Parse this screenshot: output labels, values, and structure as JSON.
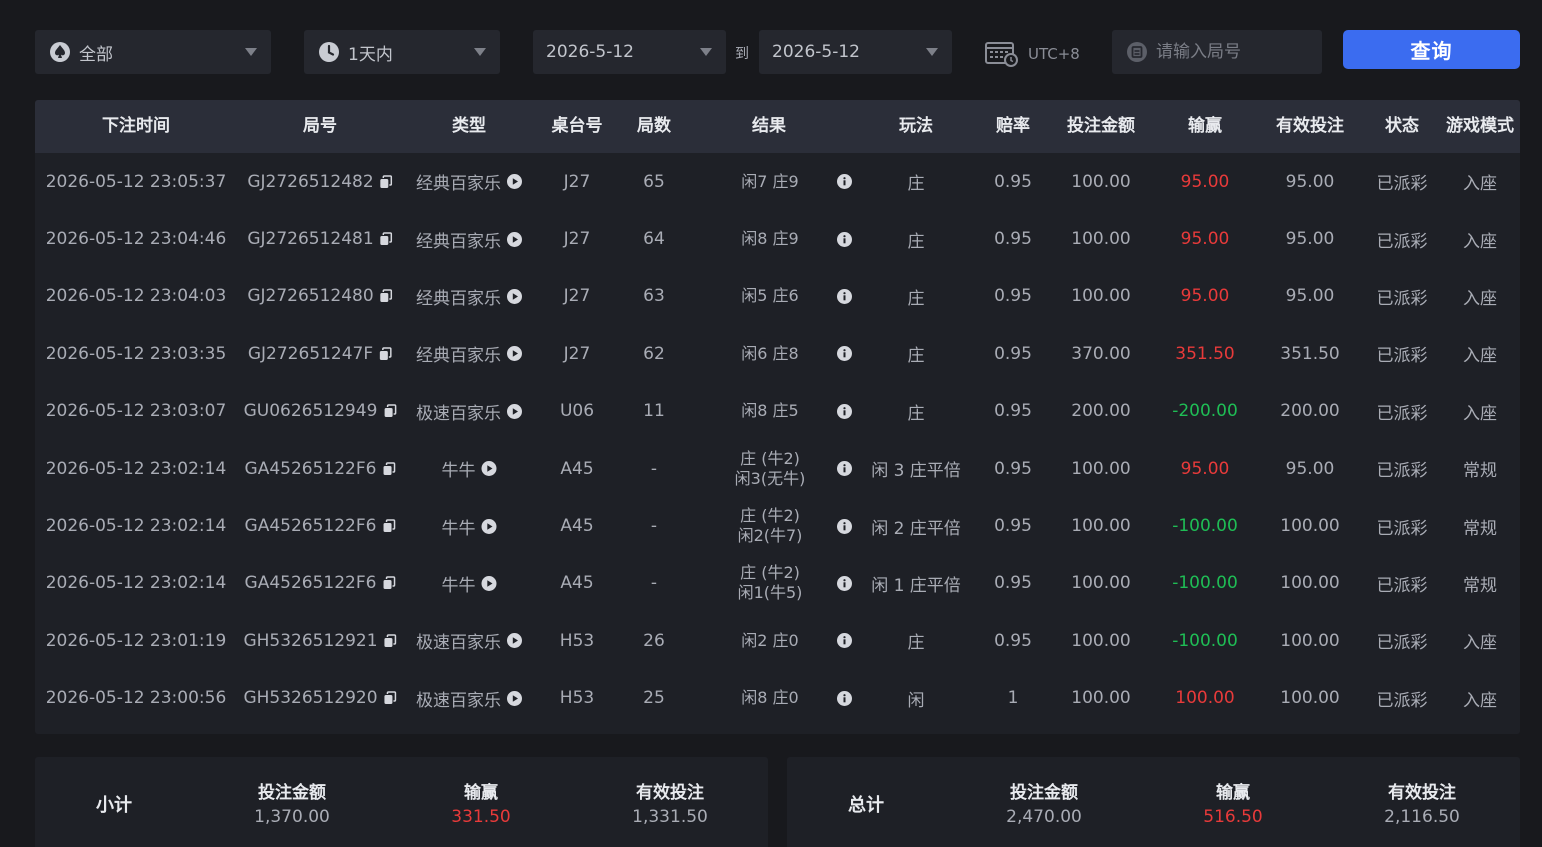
{
  "filters": {
    "type": {
      "value": "全部",
      "icon": "spade-icon"
    },
    "range": {
      "value": "1天内",
      "icon": "clock-icon"
    },
    "start_date": "2026-5-12",
    "to_label": "到",
    "end_date": "2026-5-12",
    "timezone": "UTC+8",
    "round_placeholder": "请输入局号",
    "query_label": "查询"
  },
  "colors": {
    "accent": "#3b6cf0",
    "win": "#e83a3a",
    "loss": "#1fbd55",
    "background": "#18191d",
    "panel": "#1e2026",
    "header": "#2b2e39"
  },
  "table": {
    "headers": [
      "下注时间",
      "局号",
      "类型",
      "桌台号",
      "局数",
      "结果",
      "玩法",
      "赔率",
      "投注金额",
      "输赢",
      "有效投注",
      "状态",
      "游戏模式"
    ],
    "rows": [
      {
        "time": "2026-05-12 23:05:37",
        "round": "GJ2726512482",
        "type": "经典百家乐",
        "table": "J27",
        "count": "65",
        "result": [
          "闲7 庄9"
        ],
        "play": "庄",
        "odds": "0.95",
        "bet": "100.00",
        "winloss": "95.00",
        "valid": "95.00",
        "status": "已派彩",
        "mode": "入座"
      },
      {
        "time": "2026-05-12 23:04:46",
        "round": "GJ2726512481",
        "type": "经典百家乐",
        "table": "J27",
        "count": "64",
        "result": [
          "闲8 庄9"
        ],
        "play": "庄",
        "odds": "0.95",
        "bet": "100.00",
        "winloss": "95.00",
        "valid": "95.00",
        "status": "已派彩",
        "mode": "入座"
      },
      {
        "time": "2026-05-12 23:04:03",
        "round": "GJ2726512480",
        "type": "经典百家乐",
        "table": "J27",
        "count": "63",
        "result": [
          "闲5 庄6"
        ],
        "play": "庄",
        "odds": "0.95",
        "bet": "100.00",
        "winloss": "95.00",
        "valid": "95.00",
        "status": "已派彩",
        "mode": "入座"
      },
      {
        "time": "2026-05-12 23:03:35",
        "round": "GJ272651247F",
        "type": "经典百家乐",
        "table": "J27",
        "count": "62",
        "result": [
          "闲6 庄8"
        ],
        "play": "庄",
        "odds": "0.95",
        "bet": "370.00",
        "winloss": "351.50",
        "valid": "351.50",
        "status": "已派彩",
        "mode": "入座"
      },
      {
        "time": "2026-05-12 23:03:07",
        "round": "GU0626512949",
        "type": "极速百家乐",
        "table": "U06",
        "count": "11",
        "result": [
          "闲8 庄5"
        ],
        "play": "庄",
        "odds": "0.95",
        "bet": "200.00",
        "winloss": "-200.00",
        "valid": "200.00",
        "status": "已派彩",
        "mode": "入座"
      },
      {
        "time": "2026-05-12 23:02:14",
        "round": "GA45265122F6",
        "type": "牛牛",
        "table": "A45",
        "count": "-",
        "result": [
          "庄 (牛2)",
          "闲3(无牛)"
        ],
        "play": "闲 3 庄平倍",
        "odds": "0.95",
        "bet": "100.00",
        "winloss": "95.00",
        "valid": "95.00",
        "status": "已派彩",
        "mode": "常规"
      },
      {
        "time": "2026-05-12 23:02:14",
        "round": "GA45265122F6",
        "type": "牛牛",
        "table": "A45",
        "count": "-",
        "result": [
          "庄 (牛2)",
          "闲2(牛7)"
        ],
        "play": "闲 2 庄平倍",
        "odds": "0.95",
        "bet": "100.00",
        "winloss": "-100.00",
        "valid": "100.00",
        "status": "已派彩",
        "mode": "常规"
      },
      {
        "time": "2026-05-12 23:02:14",
        "round": "GA45265122F6",
        "type": "牛牛",
        "table": "A45",
        "count": "-",
        "result": [
          "庄 (牛2)",
          "闲1(牛5)"
        ],
        "play": "闲 1 庄平倍",
        "odds": "0.95",
        "bet": "100.00",
        "winloss": "-100.00",
        "valid": "100.00",
        "status": "已派彩",
        "mode": "常规"
      },
      {
        "time": "2026-05-12 23:01:19",
        "round": "GH5326512921",
        "type": "极速百家乐",
        "table": "H53",
        "count": "26",
        "result": [
          "闲2 庄0"
        ],
        "play": "庄",
        "odds": "0.95",
        "bet": "100.00",
        "winloss": "-100.00",
        "valid": "100.00",
        "status": "已派彩",
        "mode": "入座"
      },
      {
        "time": "2026-05-12 23:00:56",
        "round": "GH5326512920",
        "type": "极速百家乐",
        "table": "H53",
        "count": "25",
        "result": [
          "闲8 庄0"
        ],
        "play": "闲",
        "odds": "1",
        "bet": "100.00",
        "winloss": "100.00",
        "valid": "100.00",
        "status": "已派彩",
        "mode": "入座"
      }
    ]
  },
  "subtotal": {
    "title": "小计",
    "bet_label": "投注金额",
    "bet": "1,370.00",
    "winloss_label": "输赢",
    "winloss": "331.50",
    "valid_label": "有效投注",
    "valid": "1,331.50"
  },
  "total": {
    "title": "总计",
    "bet_label": "投注金额",
    "bet": "2,470.00",
    "winloss_label": "输赢",
    "winloss": "516.50",
    "valid_label": "有效投注",
    "valid": "2,116.50"
  }
}
